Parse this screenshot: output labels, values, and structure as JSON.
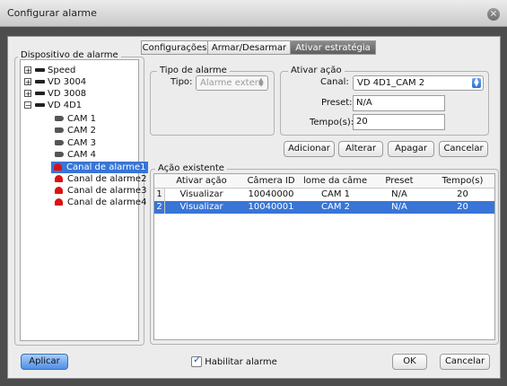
{
  "window": {
    "title": "Configurar alarme",
    "close_glyph": "×"
  },
  "tabs": [
    {
      "label": "Configurações",
      "active": false
    },
    {
      "label": "Armar/Desarmar",
      "active": false
    },
    {
      "label": "Ativar estratégia",
      "active": true
    }
  ],
  "device_panel": {
    "title": "Dispositivo de alarme",
    "tree": [
      {
        "label": "Speed",
        "icon": "dvr-icon",
        "expander": "+"
      },
      {
        "label": "VD 3004",
        "icon": "dvr-icon",
        "expander": "+"
      },
      {
        "label": "VD 3008",
        "icon": "dvr-icon",
        "expander": "+"
      },
      {
        "label": "VD 4D1",
        "icon": "dvr-icon",
        "expander": "−"
      },
      {
        "label": "CAM 1",
        "icon": "camera-icon"
      },
      {
        "label": "CAM 2",
        "icon": "camera-icon"
      },
      {
        "label": "CAM 3",
        "icon": "camera-icon"
      },
      {
        "label": "CAM 4",
        "icon": "camera-icon"
      },
      {
        "label": "Canal de alarme1",
        "icon": "alarm-bell-icon",
        "selected": true
      },
      {
        "label": "Canal de alarme2",
        "icon": "alarm-bell-icon"
      },
      {
        "label": "Canal de alarme3",
        "icon": "alarm-bell-icon"
      },
      {
        "label": "Canal de alarme4",
        "icon": "alarm-bell-icon"
      }
    ]
  },
  "alarm_type": {
    "title": "Tipo de alarme",
    "type_label": "Tipo:",
    "type_value": "Alarme extern"
  },
  "activate_action": {
    "title": "Ativar ação",
    "channel_label": "Canal:",
    "channel_value": "VD 4D1_CAM 2",
    "preset_label": "Preset:",
    "preset_value": "N/A",
    "time_label": "Tempo(s):",
    "time_value": "20"
  },
  "action_buttons": {
    "add": "Adicionar",
    "change": "Alterar",
    "delete": "Apagar",
    "cancel": "Cancelar"
  },
  "existing_actions": {
    "title": "Ação existente",
    "columns": [
      "Ativar ação",
      "Câmera ID",
      "lome da câmer",
      "Preset",
      "Tempo(s)"
    ],
    "rows": [
      {
        "num": "1",
        "cells": [
          "Visualizar",
          "10040000",
          "CAM 1",
          "N/A",
          "20"
        ],
        "selected": false
      },
      {
        "num": "2",
        "cells": [
          "Visualizar",
          "10040001",
          "CAM 2",
          "N/A",
          "20"
        ],
        "selected": true
      }
    ]
  },
  "footer": {
    "apply": "Aplicar",
    "enable_alarm": "Habilitar alarme",
    "enable_checked": true,
    "check_glyph": "✓",
    "ok": "OK",
    "cancel": "Cancelar"
  },
  "colors": {
    "selection": "#3875d7",
    "active_tab": "#6e6e6e",
    "apply_button": "#5a98e8"
  }
}
